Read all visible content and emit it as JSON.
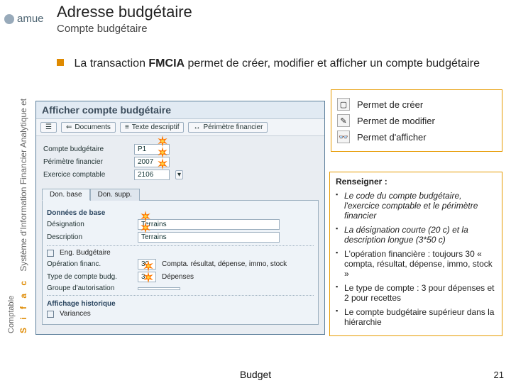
{
  "brand": {
    "name": "amue"
  },
  "header": {
    "title": "Adresse budgétaire",
    "subtitle": "Compte budgétaire"
  },
  "sidebar": {
    "sifac": "S i f a c",
    "line1": "Système d'Information Financier Analytique et",
    "line2": "Comptable"
  },
  "intro": {
    "pre": "La transaction ",
    "code": "FMCIA",
    "post": " permet de créer, modifier et afficher un compte budgétaire"
  },
  "legend": {
    "items": [
      {
        "icon": "▢",
        "label": "Permet de créer"
      },
      {
        "icon": "✎",
        "label": "Permet de modifier"
      },
      {
        "icon": "👓",
        "label": "Permet d'afficher"
      }
    ]
  },
  "sap": {
    "window_title": "Afficher compte budgétaire",
    "toolbar": [
      {
        "icon": "⇐",
        "label": "Documents"
      },
      {
        "icon": "≡",
        "label": "Texte descriptif"
      },
      {
        "icon": "↔",
        "label": "Périmètre financier"
      }
    ],
    "fields": {
      "compte_lbl": "Compte budgétaire",
      "compte_val": "P1",
      "perim_lbl": "Périmètre financier",
      "perim_val": "2007",
      "exerc_lbl": "Exercice comptable",
      "exerc_val": "2106"
    },
    "tabs": {
      "t1": "Don. base",
      "t2": "Don. supp."
    },
    "base": {
      "section": "Données de base",
      "desig_lbl": "Désignation",
      "desig_val": "Terrains",
      "descr_lbl": "Description",
      "descr_val": "Terrains",
      "eng_lbl": "Eng. Budgétaire",
      "op_lbl": "Opération financ.",
      "op_val": "30",
      "op_txt": "Compta. résultat, dépense, immo, stock",
      "type_lbl": "Type de compte budg.",
      "type_val": "3",
      "type_txt": "Dépenses",
      "grp_lbl": "Groupe d'autorisation",
      "hist_section": "Affichage historique",
      "variances_lbl": "Variances"
    }
  },
  "callout": {
    "title": "Renseigner :",
    "items": [
      "Le code du compte budgétaire, l'exercice comptable et le périmètre financier",
      "La désignation courte (20 c) et la description longue (3*50 c)",
      "L'opération financière : toujours 30 « compta, résultat, dépense, immo, stock »",
      "Le type de compte : 3 pour dépenses et 2 pour recettes",
      "Le compte budgétaire supérieur dans la hiérarchie"
    ]
  },
  "footer": {
    "center": "Budget",
    "page": "21"
  }
}
